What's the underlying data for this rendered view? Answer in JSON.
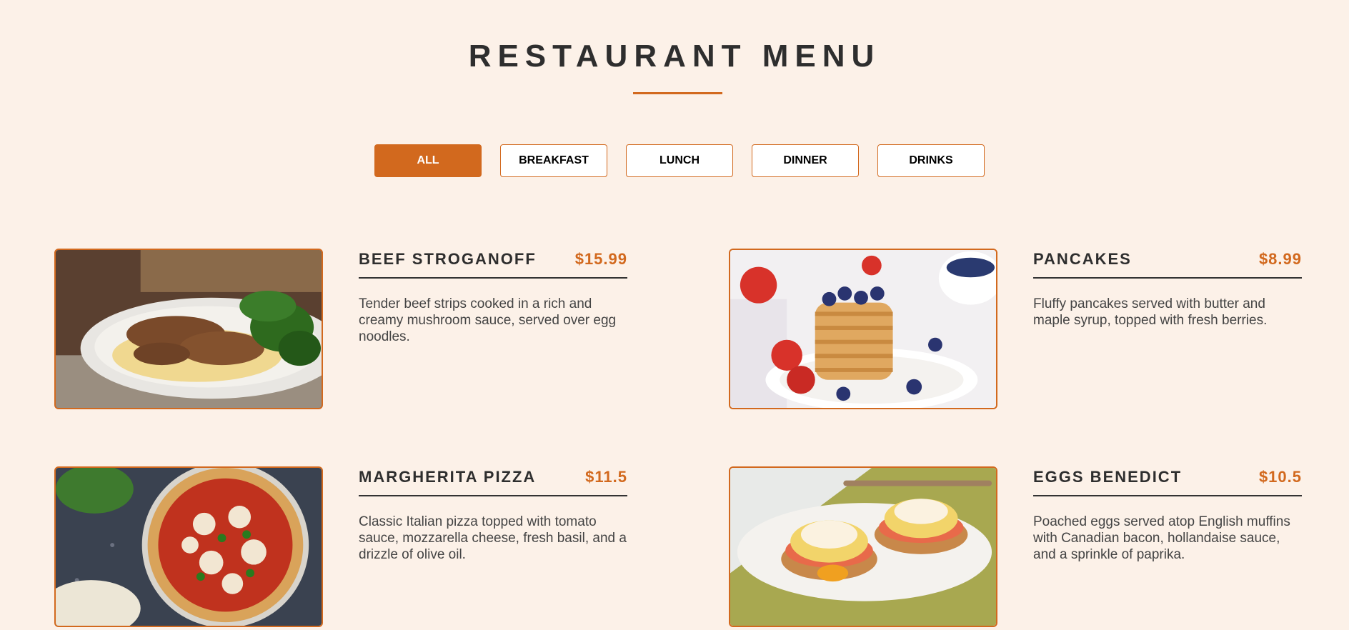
{
  "header": {
    "title": "RESTAURANT MENU"
  },
  "filters": [
    {
      "label": "ALL",
      "active": true
    },
    {
      "label": "BREAKFAST",
      "active": false
    },
    {
      "label": "LUNCH",
      "active": false
    },
    {
      "label": "DINNER",
      "active": false
    },
    {
      "label": "DRINKS",
      "active": false
    }
  ],
  "colors": {
    "accent": "#d2691e",
    "background": "#fcf1e8",
    "text": "#2e2e2e"
  },
  "items": [
    {
      "name": "BEEF STROGANOFF",
      "price": "$15.99",
      "description": "Tender beef strips cooked in a rich and creamy mushroom sauce, served over egg noodles.",
      "image": "beef-stroganoff-photo"
    },
    {
      "name": "PANCAKES",
      "price": "$8.99",
      "description": "Fluffy pancakes served with butter and maple syrup, topped with fresh berries.",
      "image": "pancakes-photo"
    },
    {
      "name": "MARGHERITA PIZZA",
      "price": "$11.5",
      "description": "Classic Italian pizza topped with tomato sauce, mozzarella cheese, fresh basil, and a drizzle of olive oil.",
      "image": "margherita-pizza-photo"
    },
    {
      "name": "EGGS BENEDICT",
      "price": "$10.5",
      "description": "Poached eggs served atop English muffins with Canadian bacon, hollandaise sauce, and a sprinkle of paprika.",
      "image": "eggs-benedict-photo"
    }
  ]
}
